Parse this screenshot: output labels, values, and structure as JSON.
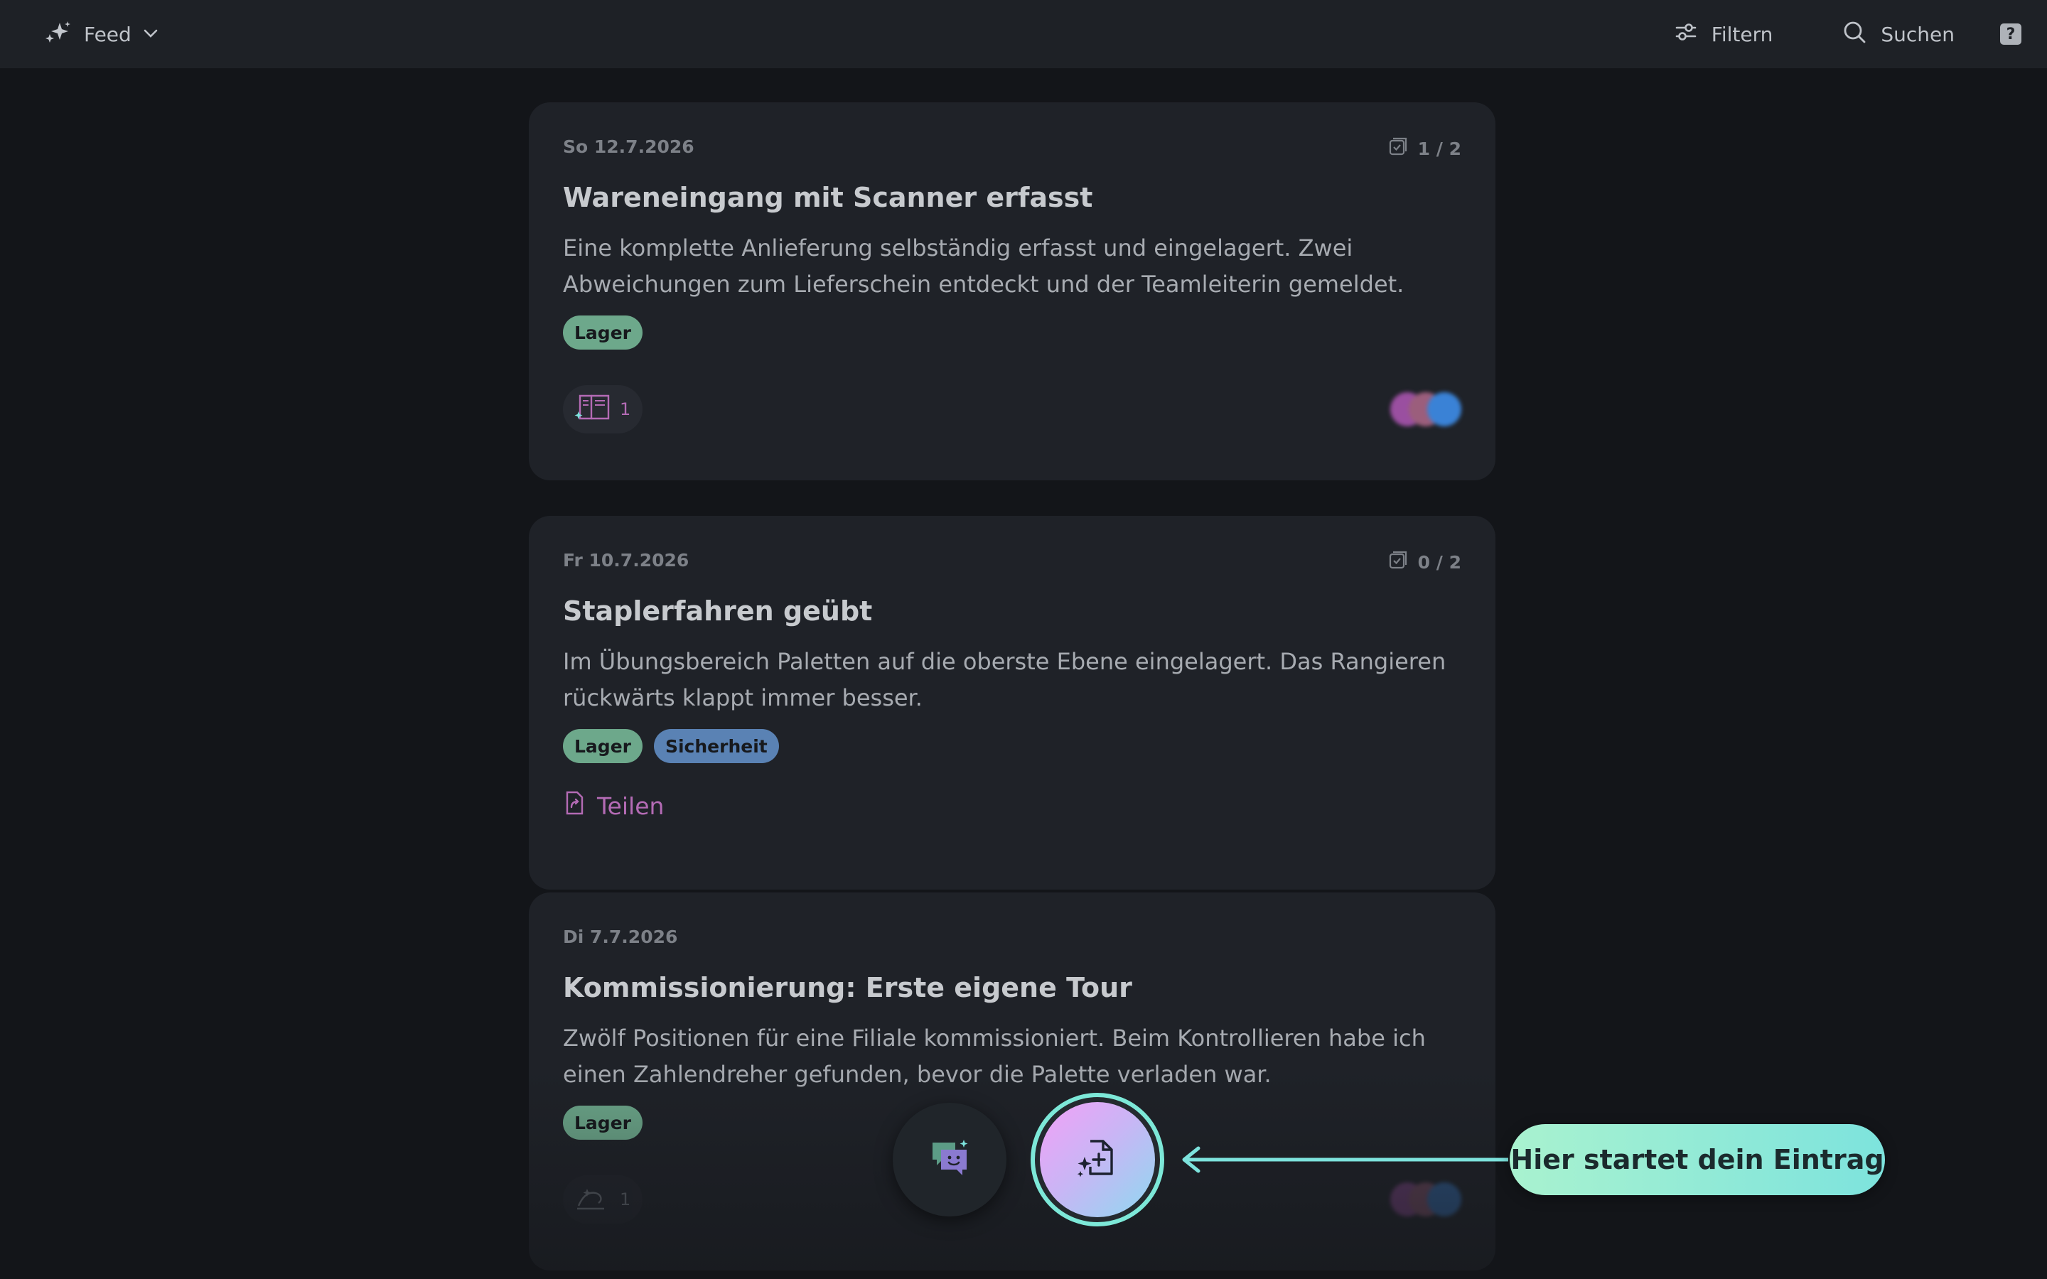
{
  "topbar": {
    "feed_label": "Feed",
    "filter_label": "Filtern",
    "search_label": "Suchen",
    "help_label": "?"
  },
  "cards": [
    {
      "date": "So 12.7.2026",
      "progress": "1 / 2",
      "title": "Wareneingang mit Scanner erfasst",
      "text": "Eine komplette Anlieferung selbständig erfasst und eingelagert. Zwei Abweichungen zum Lieferschein entdeckt und der Teamleiterin gemeldet.",
      "tags": [
        "Lager"
      ],
      "chip_count": "1"
    },
    {
      "date": "Fr 10.7.2026",
      "progress": "0 / 2",
      "title": "Staplerfahren geübt",
      "text": "Im Übungsbereich Paletten auf die oberste Ebene eingelagert. Das Rangieren rückwärts klappt immer besser.",
      "tags": [
        "Lager",
        "Sicherheit"
      ],
      "share_label": "Teilen"
    },
    {
      "date": "Di 7.7.2026",
      "title": "Kommissionierung: Erste eigene Tour",
      "text": "Zwölf Positionen für eine Filiale kommissioniert. Beim Kontrollieren habe ich einen Zahlendreher gefunden, bevor die Palette verladen war.",
      "tags": [
        "Lager"
      ],
      "chip_count": "1"
    }
  ],
  "onboarding": {
    "hint": "Hier startet dein Eintrag"
  },
  "colors": {
    "background": "#131519",
    "card": "#1f2228",
    "accent_pink": "#b46bb5",
    "tag_lager": "#6da88b",
    "tag_sicherheit": "#5a82b4",
    "hint_teal": "#7de3dd"
  },
  "icons": {
    "feed": "sparkles-icon",
    "filter": "sliders-icon",
    "search": "search-icon",
    "help": "question-mark-icon",
    "progress": "checklist-icon",
    "chip": "reflection-book-icon",
    "share": "share-document-icon",
    "secondary_action": "chat-smile-icon",
    "primary_action": "new-entry-sparkle-icon"
  }
}
